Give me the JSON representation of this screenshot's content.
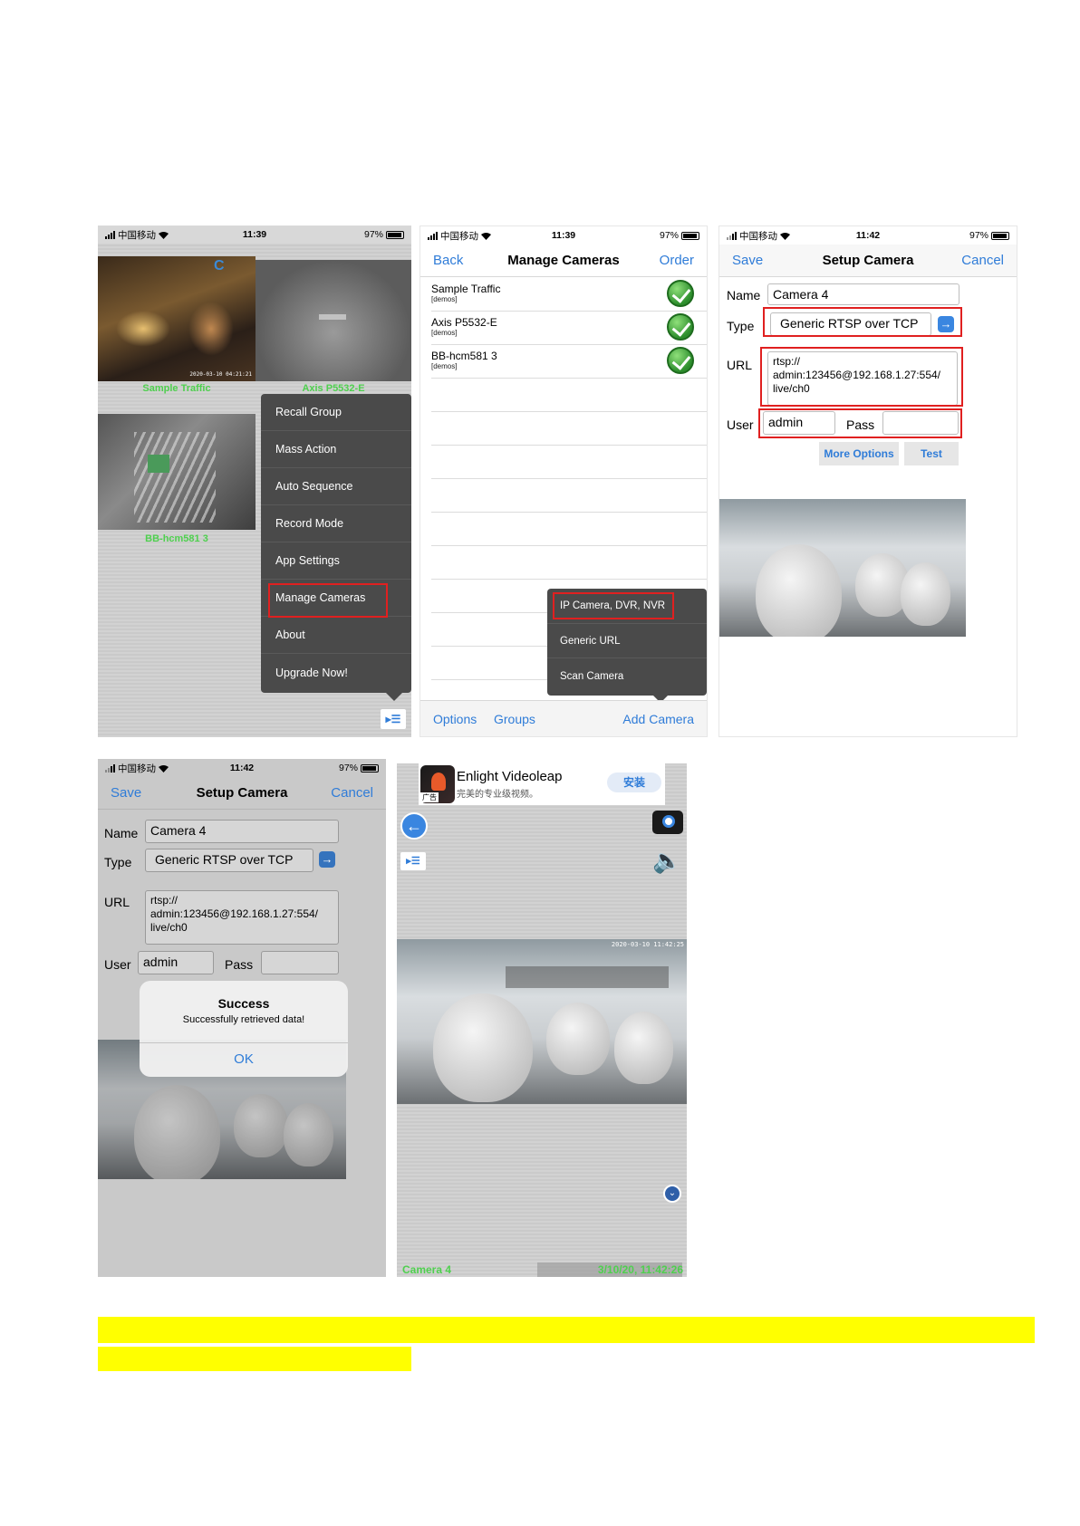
{
  "screen1": {
    "status": {
      "carrier": "中国移动",
      "time": "11:39",
      "battery": "97%"
    },
    "cameras": [
      {
        "label": "Sample Traffic",
        "overlay": "2020-03-10 04:21:21"
      },
      {
        "label": "Axis P5532-E"
      },
      {
        "label": "BB-hcm581 3"
      }
    ],
    "menu": [
      "Recall Group",
      "Mass Action",
      "Auto Sequence",
      "Record Mode",
      "App Settings",
      "Manage Cameras",
      "About",
      "Upgrade Now!"
    ],
    "menu_button_icon": "menu-list-icon"
  },
  "screen2": {
    "status": {
      "carrier": "中国移动",
      "time": "11:39",
      "battery": "97%"
    },
    "nav": {
      "left": "Back",
      "title": "Manage Cameras",
      "right": "Order"
    },
    "list": [
      {
        "name": "Sample Traffic",
        "sub": "[demos]"
      },
      {
        "name": "Axis P5532-E",
        "sub": "[demos]"
      },
      {
        "name": "BB-hcm581 3",
        "sub": "[demos]"
      }
    ],
    "popup": [
      "IP Camera, DVR, NVR",
      "Generic URL",
      "Scan Camera"
    ],
    "toolbar": {
      "options": "Options",
      "groups": "Groups",
      "add": "Add Camera"
    }
  },
  "screen3": {
    "status": {
      "carrier": "中国移动",
      "time": "11:42",
      "battery": "97%"
    },
    "nav": {
      "left": "Save",
      "title": "Setup Camera",
      "right": "Cancel"
    },
    "form": {
      "name_label": "Name",
      "name_value": "Camera 4",
      "type_label": "Type",
      "type_value": "Generic RTSP over TCP",
      "url_label": "URL",
      "url_value": "rtsp://\nadmin:123456@192.168.1.27:554/\nlive/ch0",
      "user_label": "User",
      "user_value": "admin",
      "pass_label": "Pass",
      "pass_value": "",
      "more_options": "More Options",
      "test": "Test"
    }
  },
  "screen4": {
    "status": {
      "carrier": "中国移动",
      "time": "11:42",
      "battery": "97%"
    },
    "nav": {
      "left": "Save",
      "title": "Setup Camera",
      "right": "Cancel"
    },
    "form": {
      "name_label": "Name",
      "name_value": "Camera 4",
      "type_label": "Type",
      "type_value": "Generic RTSP over TCP",
      "url_label": "URL",
      "url_value": "rtsp://\nadmin:123456@192.168.1.27:554/\nlive/ch0",
      "user_label": "User",
      "user_value": "admin",
      "pass_label": "Pass"
    },
    "alert": {
      "title": "Success",
      "message": "Successfully retrieved data!",
      "ok": "OK"
    }
  },
  "screen5": {
    "ad": {
      "title": "Enlight Videoleap",
      "subtitle": "完美的专业级视频。",
      "tag": "广告",
      "install": "安装"
    },
    "video_timestamp": "2020-03-10 11:42:25",
    "camera_name": "Camera 4",
    "datetime": "3/10/20, 11:42:26"
  },
  "colors": {
    "accent": "#2f7cd8",
    "highlight_box": "#e02020",
    "label_green": "#4ed04e",
    "highlight_bar": "#ffff00"
  }
}
